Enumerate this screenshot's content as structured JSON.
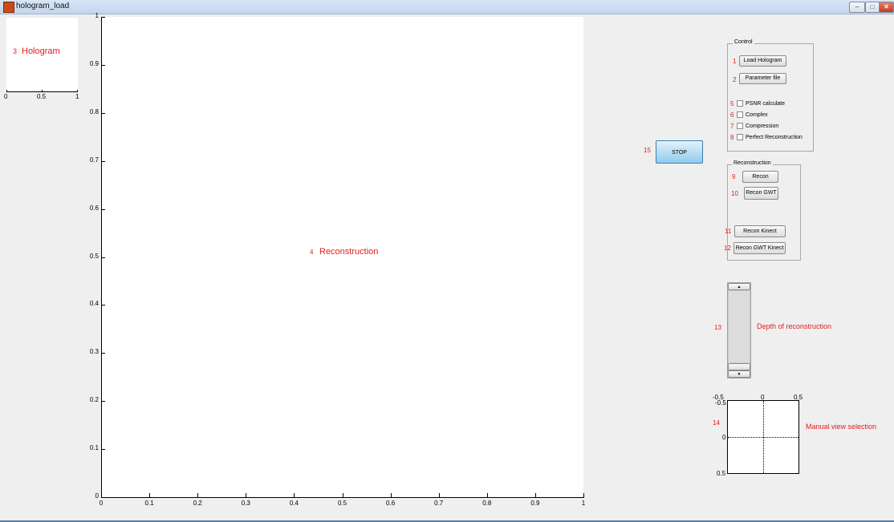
{
  "window": {
    "title": "hologram_load",
    "min_icon": "minimize-icon",
    "max_icon": "maximize-icon",
    "close_icon": "close-icon",
    "close_label": "✕"
  },
  "hologram_axes": {
    "label_num": "3",
    "label": "Hologram",
    "x_ticks": [
      "0",
      "0.5",
      "1"
    ]
  },
  "reconstruction_axes": {
    "label_num": "4",
    "label": "Reconstruction",
    "y_ticks": [
      "0",
      "0.1",
      "0.2",
      "0.3",
      "0.4",
      "0.5",
      "0.6",
      "0.7",
      "0.8",
      "0.9",
      "1"
    ],
    "x_ticks": [
      "0",
      "0.1",
      "0.2",
      "0.3",
      "0.4",
      "0.5",
      "0.6",
      "0.7",
      "0.8",
      "0.9",
      "1"
    ]
  },
  "control_panel": {
    "title": "Control",
    "load_num": "1",
    "load_label": "Load Hologram",
    "param_num": "2",
    "param_label": "Parameter file",
    "options": [
      {
        "num": "5",
        "label": "PSNR calculate",
        "checked": false
      },
      {
        "num": "6",
        "label": "Complex",
        "checked": false
      },
      {
        "num": "7",
        "label": "Compression",
        "checked": false
      },
      {
        "num": "8",
        "label": "Perfect Reconstruction",
        "checked": false
      }
    ]
  },
  "reconstruction_panel": {
    "title": "Reconstruction",
    "buttons": [
      {
        "num": "9",
        "label": "Recon"
      },
      {
        "num": "10",
        "label": "Recon GWT"
      },
      {
        "num": "11",
        "label": "Recon Kinect"
      },
      {
        "num": "12",
        "label": "Recon GWT Kinect"
      }
    ]
  },
  "stop": {
    "num": "15",
    "label": "STOP"
  },
  "depth_slider": {
    "num": "13",
    "label": "Depth of reconstruction",
    "up_glyph": "▲",
    "down_glyph": "▼"
  },
  "view_selection": {
    "num": "14",
    "label": "Manual view selection",
    "top_ticks": [
      "-0.5",
      "0",
      "0.5"
    ],
    "left_ticks": [
      "-0.5",
      "0",
      "0.5"
    ]
  }
}
